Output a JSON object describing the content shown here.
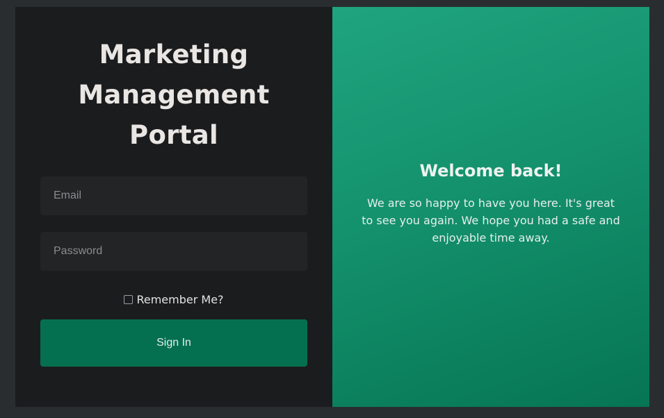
{
  "login": {
    "title_lines": [
      "Marketing",
      "Management",
      "Portal"
    ],
    "email": {
      "placeholder": "Email",
      "value": ""
    },
    "password": {
      "placeholder": "Password",
      "value": ""
    },
    "remember_label": "Remember Me?",
    "remember_checked": false,
    "signin_label": "Sign In"
  },
  "welcome": {
    "title": "Welcome back!",
    "message": "We are so happy to have you here. It's great to see you again. We hope you had a safe and enjoyable time away."
  },
  "colors": {
    "page_background": "#2a2d30",
    "login_panel": "#1b1c1e",
    "input_background": "#222426",
    "primary_button": "#05704f",
    "welcome_gradient_start": "#1fa47f",
    "welcome_gradient_end": "#067553"
  }
}
